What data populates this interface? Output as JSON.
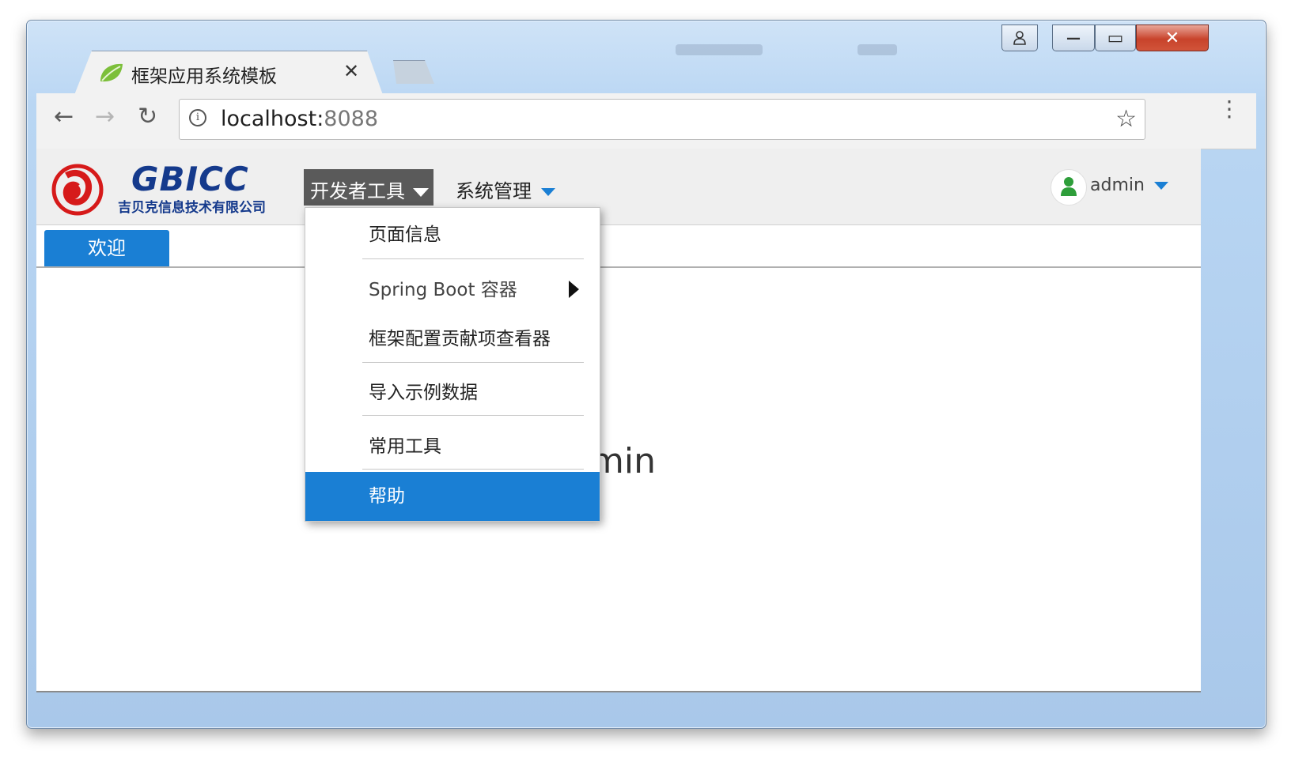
{
  "browser": {
    "tab_title": "框架应用系统模板",
    "tab_close": "✕",
    "url_host": "localhost:",
    "url_port": "8088",
    "info_icon": "i",
    "star_icon": "☆",
    "menu_dots": "⋮",
    "back_icon": "←",
    "forward_icon": "→",
    "reload_icon": "↻"
  },
  "window_controls": {
    "user_icon": "user-icon",
    "minimize": "—",
    "maximize": "▭",
    "close": "✕"
  },
  "app": {
    "logo_text": "GBICC",
    "logo_subtitle": "吉贝克信息技术有限公司",
    "nav": {
      "dev_tools": "开发者工具",
      "system_mgmt": "系统管理"
    },
    "user": {
      "name": "admin"
    },
    "tabs": [
      {
        "label": "欢迎"
      }
    ],
    "greeting_visible": "min"
  },
  "dropdown": {
    "items": [
      {
        "label": "页面信息",
        "has_submenu": false,
        "active": false
      },
      {
        "label": "Spring Boot 容器",
        "has_submenu": true,
        "active": false
      },
      {
        "label": "框架配置贡献项查看器",
        "has_submenu": false,
        "active": false
      },
      {
        "label": "导入示例数据",
        "has_submenu": false,
        "active": false
      },
      {
        "label": "常用工具",
        "has_submenu": false,
        "active": false
      },
      {
        "label": "帮助",
        "has_submenu": false,
        "active": true
      }
    ]
  },
  "colors": {
    "accent": "#1a7fd4",
    "dev_button_bg": "#5a5a5a",
    "logo_blue": "#153a8c",
    "logo_red": "#d61a1a",
    "user_icon_green": "#2e9e3a"
  }
}
